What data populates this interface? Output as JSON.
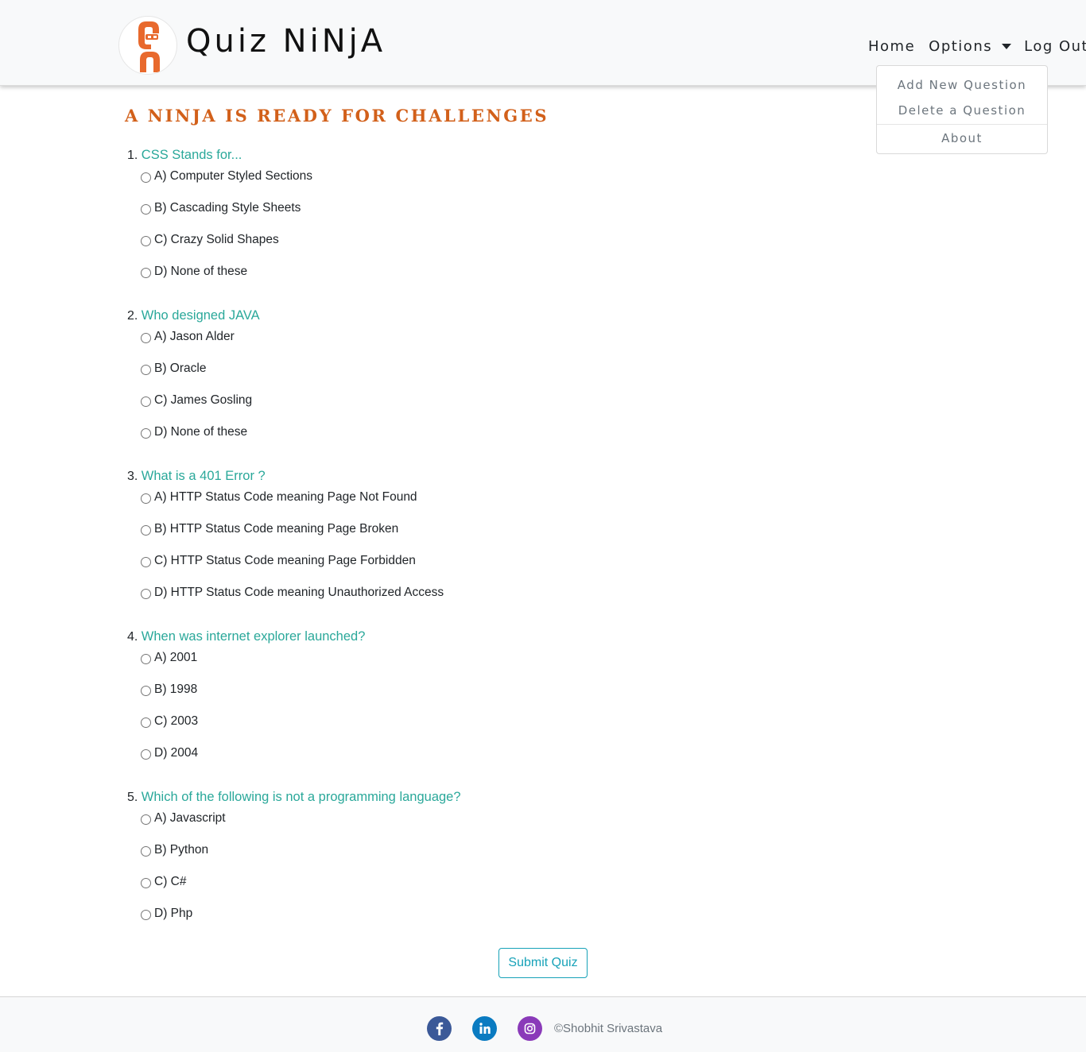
{
  "navbar": {
    "brand": "Quiz NiNjA",
    "links": {
      "home": "Home",
      "options": "Options",
      "logout": "Log Out"
    }
  },
  "dropdown": {
    "items": [
      "Add New Question",
      "Delete a Question",
      "About"
    ]
  },
  "main": {
    "heading": "A NINJA IS READY FOR CHALLENGES",
    "questions": [
      {
        "number": "1.",
        "text": "CSS Stands for...",
        "options": [
          "A) Computer Styled Sections",
          "B) Cascading Style Sheets",
          "C) Crazy Solid Shapes",
          "D) None of these"
        ]
      },
      {
        "number": "2.",
        "text": "Who designed JAVA",
        "options": [
          "A) Jason Alder",
          "B) Oracle",
          "C) James Gosling",
          "D) None of these"
        ]
      },
      {
        "number": "3.",
        "text": "What is a 401 Error ?",
        "options": [
          "A) HTTP Status Code meaning Page Not Found",
          "B) HTTP Status Code meaning Page Broken",
          "C) HTTP Status Code meaning Page Forbidden",
          "D) HTTP Status Code meaning Unauthorized Access"
        ]
      },
      {
        "number": "4.",
        "text": "When was internet explorer launched?",
        "options": [
          "A) 2001",
          "B) 1998",
          "C) 2003",
          "D) 2004"
        ]
      },
      {
        "number": "5.",
        "text": "Which of the following is not a programming language?",
        "options": [
          "A) Javascript",
          "B) Python",
          "C) C#",
          "D) Php"
        ]
      }
    ],
    "submit_label": "Submit Quiz"
  },
  "footer": {
    "copyright": "©Shobhit Srivastava",
    "icons": [
      "facebook-icon",
      "linkedin-icon",
      "instagram-icon"
    ]
  },
  "colors": {
    "heading": "#d2601a",
    "question_text": "#2aa89a",
    "submit": "#17a2b8",
    "facebook": "#3b5998",
    "linkedin": "#0a7bc1",
    "instagram": "#8a3ab9",
    "logo": "#e8692d"
  }
}
